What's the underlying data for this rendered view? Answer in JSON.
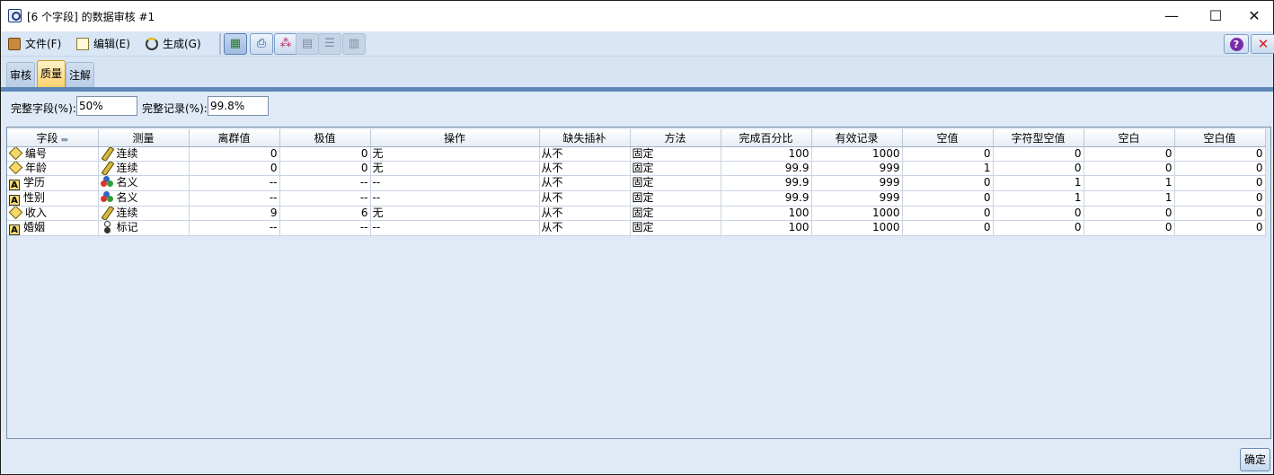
{
  "window": {
    "title": "[6 个字段] 的数据审核 #1",
    "minimize": "—",
    "maximize": "☐",
    "close": "✕"
  },
  "menu": {
    "file": "文件(F)",
    "edit": "编辑(E)",
    "generate": "生成(G)"
  },
  "toolbar_icons": [
    "table-icon",
    "print-icon",
    "chart-icon",
    "grid-view-icon",
    "list-view-icon",
    "column-view-icon"
  ],
  "help_button": "?",
  "close_button": "✕",
  "tabs": [
    "审核",
    "质量",
    "注解"
  ],
  "selected_tab": "质量",
  "summary": {
    "complete_fields_label": "完整字段(%):",
    "complete_fields_value": "50%",
    "complete_records_label": "完整记录(%):",
    "complete_records_value": "99.8%"
  },
  "ok_button": "确定",
  "chart_data": {
    "type": "table",
    "columns": [
      "字段",
      "测量",
      "离群值",
      "极值",
      "操作",
      "缺失插补",
      "方法",
      "完成百分比",
      "有效记录",
      "空值",
      "字符型空值",
      "空白",
      "空白值"
    ],
    "rows": [
      {
        "field": "编号",
        "type_icon": "continuous-field-icon",
        "measure_icon": "ruler-icon",
        "measure": "连续",
        "outliers": "0",
        "extremes": "0",
        "action": "无",
        "impute": "从不",
        "method": "固定",
        "pct_complete": "100",
        "valid": "1000",
        "null": "0",
        "string_null": "0",
        "blank": "0",
        "blank_value": "0"
      },
      {
        "field": "年龄",
        "type_icon": "continuous-field-icon",
        "measure_icon": "ruler-icon",
        "measure": "连续",
        "outliers": "0",
        "extremes": "0",
        "action": "无",
        "impute": "从不",
        "method": "固定",
        "pct_complete": "99.9",
        "valid": "999",
        "null": "1",
        "string_null": "0",
        "blank": "0",
        "blank_value": "0"
      },
      {
        "field": "学历",
        "type_icon": "string-field-icon",
        "measure_icon": "nominal-icon",
        "measure": "名义",
        "outliers": "--",
        "extremes": "--",
        "action": "--",
        "impute": "从不",
        "method": "固定",
        "pct_complete": "99.9",
        "valid": "999",
        "null": "0",
        "string_null": "1",
        "blank": "1",
        "blank_value": "0"
      },
      {
        "field": "性别",
        "type_icon": "string-field-icon",
        "measure_icon": "nominal-icon",
        "measure": "名义",
        "outliers": "--",
        "extremes": "--",
        "action": "--",
        "impute": "从不",
        "method": "固定",
        "pct_complete": "99.9",
        "valid": "999",
        "null": "0",
        "string_null": "1",
        "blank": "1",
        "blank_value": "0"
      },
      {
        "field": "收入",
        "type_icon": "continuous-field-icon",
        "measure_icon": "ruler-icon",
        "measure": "连续",
        "outliers": "9",
        "extremes": "6",
        "action": "无",
        "impute": "从不",
        "method": "固定",
        "pct_complete": "100",
        "valid": "1000",
        "null": "0",
        "string_null": "0",
        "blank": "0",
        "blank_value": "0"
      },
      {
        "field": "婚姻",
        "type_icon": "string-field-icon",
        "measure_icon": "flag-icon",
        "measure": "标记",
        "outliers": "--",
        "extremes": "--",
        "action": "--",
        "impute": "从不",
        "method": "固定",
        "pct_complete": "100",
        "valid": "1000",
        "null": "0",
        "string_null": "0",
        "blank": "0",
        "blank_value": "0"
      }
    ]
  }
}
